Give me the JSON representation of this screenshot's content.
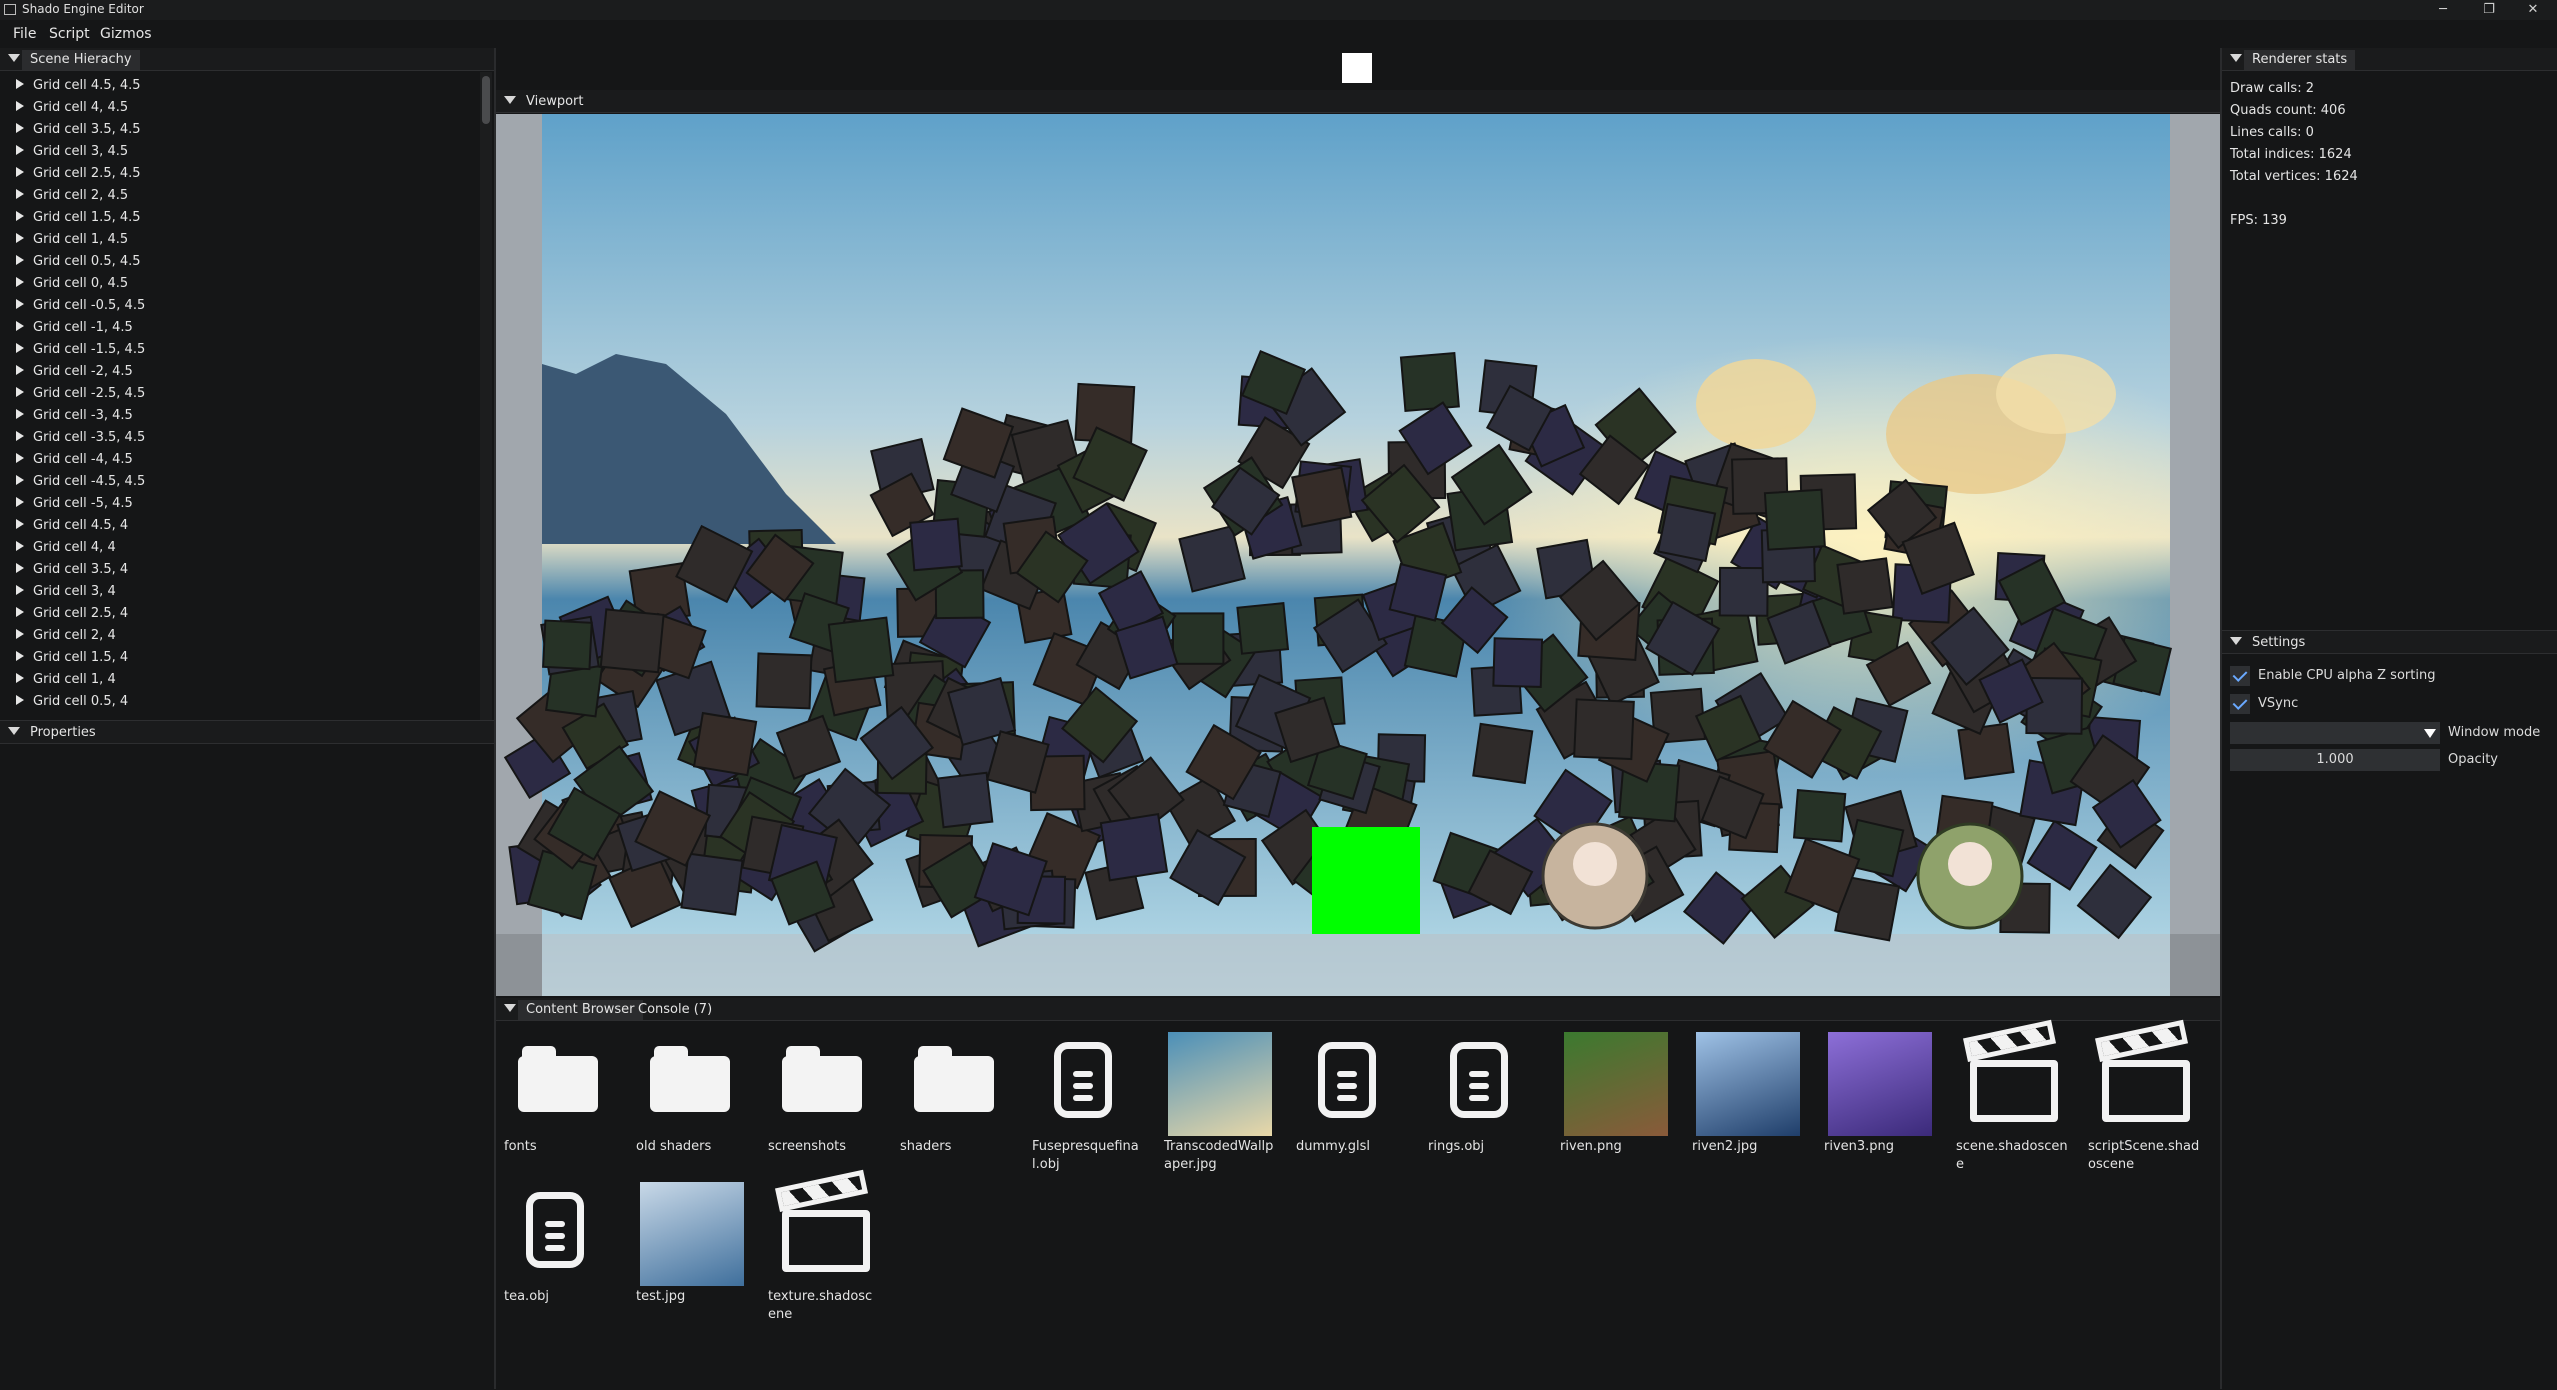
{
  "window": {
    "title": "Shado Engine Editor",
    "minimize_glyph": "─",
    "restore_glyph": "❐",
    "close_glyph": "✕"
  },
  "menu": [
    "File",
    "Script",
    "Gizmos"
  ],
  "scene_hierarchy": {
    "title": "Scene Hierachy",
    "items": [
      "Grid cell 4.5, 4.5",
      "Grid cell 4, 4.5",
      "Grid cell 3.5, 4.5",
      "Grid cell 3, 4.5",
      "Grid cell 2.5, 4.5",
      "Grid cell 2, 4.5",
      "Grid cell 1.5, 4.5",
      "Grid cell 1, 4.5",
      "Grid cell 0.5, 4.5",
      "Grid cell 0, 4.5",
      "Grid cell -0.5, 4.5",
      "Grid cell -1, 4.5",
      "Grid cell -1.5, 4.5",
      "Grid cell -2, 4.5",
      "Grid cell -2.5, 4.5",
      "Grid cell -3, 4.5",
      "Grid cell -3.5, 4.5",
      "Grid cell -4, 4.5",
      "Grid cell -4.5, 4.5",
      "Grid cell -5, 4.5",
      "Grid cell 4.5, 4",
      "Grid cell 4, 4",
      "Grid cell 3.5, 4",
      "Grid cell 3, 4",
      "Grid cell 2.5, 4",
      "Grid cell 2, 4",
      "Grid cell 1.5, 4",
      "Grid cell 1, 4",
      "Grid cell 0.5, 4"
    ]
  },
  "properties": {
    "title": "Properties"
  },
  "viewport": {
    "title": "Viewport"
  },
  "renderer_stats": {
    "title": "Renderer stats",
    "draw_calls": "Draw calls: 2",
    "quads_count": "Quads count: 406",
    "lines_calls": "Lines calls: 0",
    "total_indices": "Total indices: 1624",
    "total_vertices": "Total vertices: 1624",
    "fps": "FPS: 139"
  },
  "settings": {
    "title": "Settings",
    "alpha_sorting_label": "Enable CPU alpha Z sorting",
    "alpha_sorting_checked": true,
    "vsync_label": "VSync",
    "vsync_checked": true,
    "window_mode_label": "Window mode",
    "window_mode_value": "",
    "opacity_label": "Opacity",
    "opacity_value": "1.000"
  },
  "bottom_tabs": {
    "content_browser": "Content Browser",
    "console": "Console (7)"
  },
  "content_browser": {
    "items": [
      {
        "label": "fonts",
        "icon": "folder-icon"
      },
      {
        "label": "old shaders",
        "icon": "folder-icon"
      },
      {
        "label": "screenshots",
        "icon": "folder-icon"
      },
      {
        "label": "shaders",
        "icon": "folder-icon"
      },
      {
        "label": "Fusepresquefinal.obj",
        "icon": "file-icon"
      },
      {
        "label": "TranscodedWallpaper.jpg",
        "icon": "image-thumbnail"
      },
      {
        "label": "dummy.glsl",
        "icon": "file-icon"
      },
      {
        "label": "rings.obj",
        "icon": "file-icon"
      },
      {
        "label": "riven.png",
        "icon": "image-thumbnail"
      },
      {
        "label": "riven2.jpg",
        "icon": "image-thumbnail"
      },
      {
        "label": "riven3.png",
        "icon": "image-thumbnail"
      },
      {
        "label": "scene.shadoscene",
        "icon": "clapperboard-icon"
      },
      {
        "label": "scriptScene.shadoscene",
        "icon": "clapperboard-icon"
      },
      {
        "label": "tea.obj",
        "icon": "file-icon"
      },
      {
        "label": "test.jpg",
        "icon": "image-thumbnail"
      },
      {
        "label": "texture.shadoscene",
        "icon": "clapperboard-icon"
      }
    ]
  },
  "colors": {
    "background": "#151617",
    "panel_header": "#1a1b1c",
    "tab_active": "#2b2c2e",
    "checkbox_accent": "#6aa9ff",
    "green_box": "#00ff00"
  }
}
